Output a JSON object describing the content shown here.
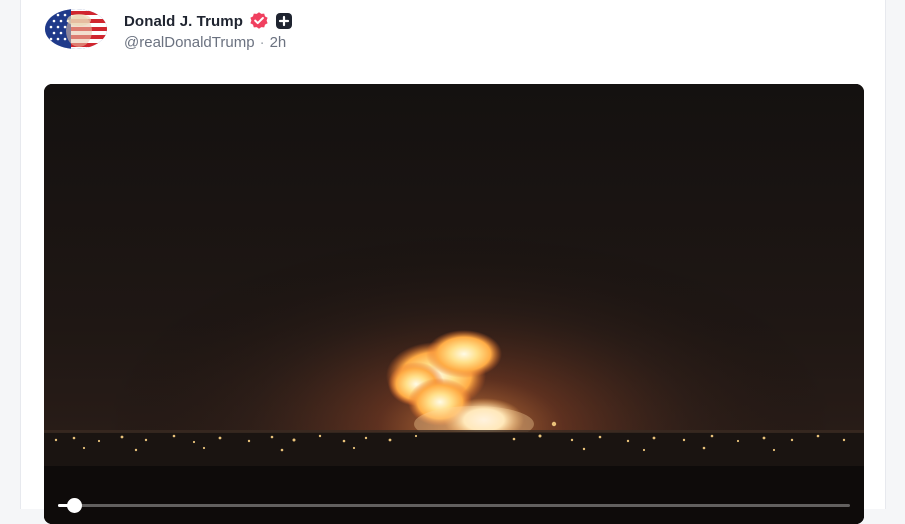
{
  "post": {
    "author_name": "Donald J. Trump",
    "handle": "@realDonaldTrump",
    "separator": "·",
    "time": "2h",
    "verified_icon": "verified-badge-icon",
    "extra_badge_icon": "plus-badge-icon",
    "avatar_icon": "avatar"
  },
  "video": {
    "progress": 0.02,
    "scene": "night explosion over distant town lights"
  },
  "colors": {
    "verified": "#f0405f",
    "badge_dark": "#1f2430",
    "handle_text": "#6b7280"
  }
}
